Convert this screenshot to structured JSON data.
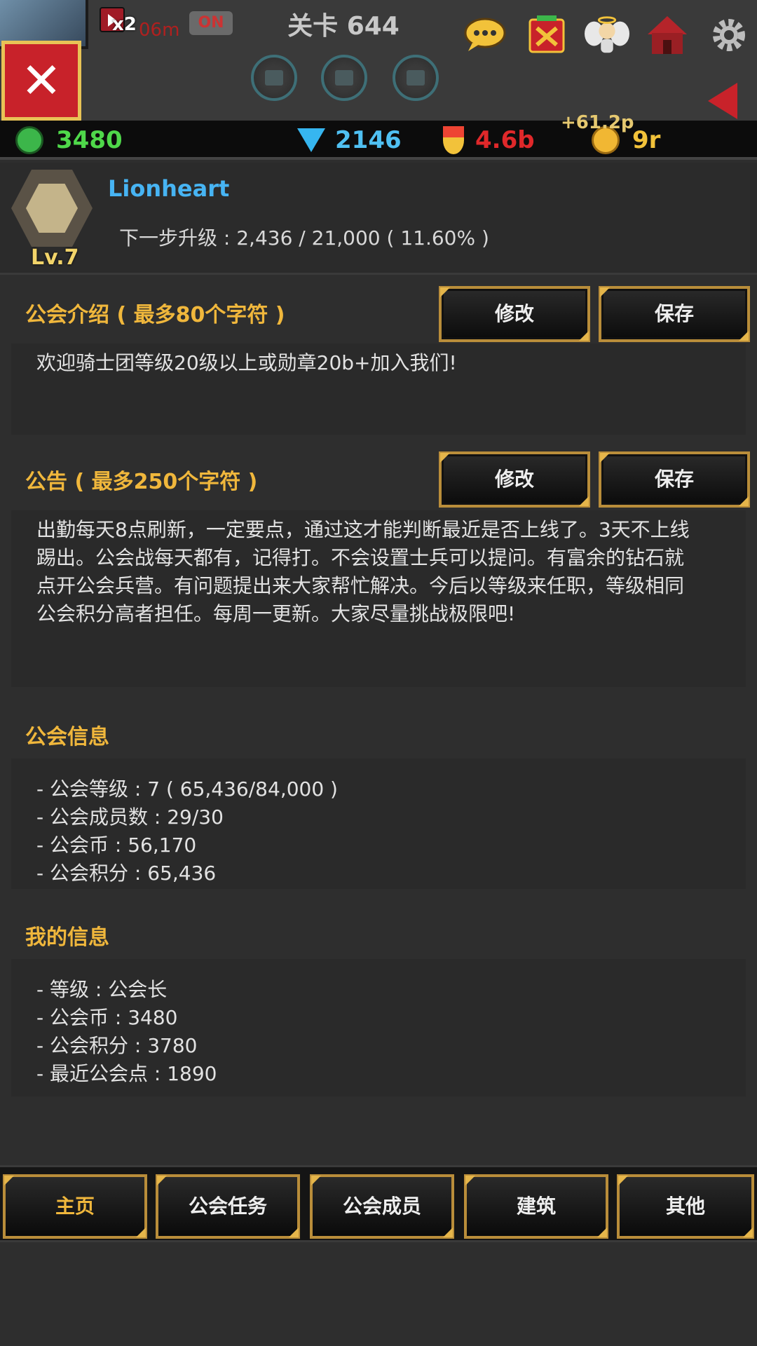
{
  "topbar": {
    "speed_multiplier": "x2",
    "speed_timer": "06m",
    "auto_toggle": "ON",
    "stage_label": "关卡 644",
    "bonus_text": "+61.2p",
    "icons": [
      "chat-icon",
      "crossed-flag-icon",
      "angel-icon",
      "house-icon",
      "gear-icon"
    ]
  },
  "resources": {
    "coin": "3480",
    "gem": "2146",
    "medal": "4.6b",
    "gold": "9r"
  },
  "guild": {
    "name": "Lionheart",
    "level": "Lv.7",
    "progress": "下一步升级 : 2,436 / 21,000 ( 11.60% )"
  },
  "intro": {
    "title": "公会介绍 ( 最多80个字符 )",
    "edit_label": "修改",
    "save_label": "保存",
    "text": "欢迎骑士团等级20级以上或勋章20b+加入我们!"
  },
  "notice": {
    "title": "公告 ( 最多250个字符 )",
    "edit_label": "修改",
    "save_label": "保存",
    "lines": [
      "出勤每天8点刷新，一定要点，通过这才能判断最近是否上线了。3天不上线",
      "踢出。公会战每天都有，记得打。不会设置士兵可以提问。有富余的钻石就",
      "点开公会兵营。有问题提出来大家帮忙解决。今后以等级来任职，等级相同",
      "公会积分高者担任。每周一更新。大家尽量挑战极限吧!"
    ]
  },
  "guild_info": {
    "title": "公会信息",
    "lines": [
      "- 公会等级 : 7  ( 65,436/84,000 )",
      "- 公会成员数 : 29/30",
      "- 公会币 : 56,170",
      "- 公会积分 : 65,436"
    ]
  },
  "my_info": {
    "title": "我的信息",
    "lines": [
      "- 等级 : 公会长",
      "- 公会币 : 3480",
      "- 公会积分 : 3780",
      "- 最近公会点 : 1890"
    ]
  },
  "tabs": [
    "主页",
    "公会任务",
    "公会成员",
    "建筑",
    "其他"
  ],
  "colors": {
    "accent_gold": "#f0b73c",
    "guild_name_blue": "#47b4f3",
    "close_red": "#c8222a"
  }
}
